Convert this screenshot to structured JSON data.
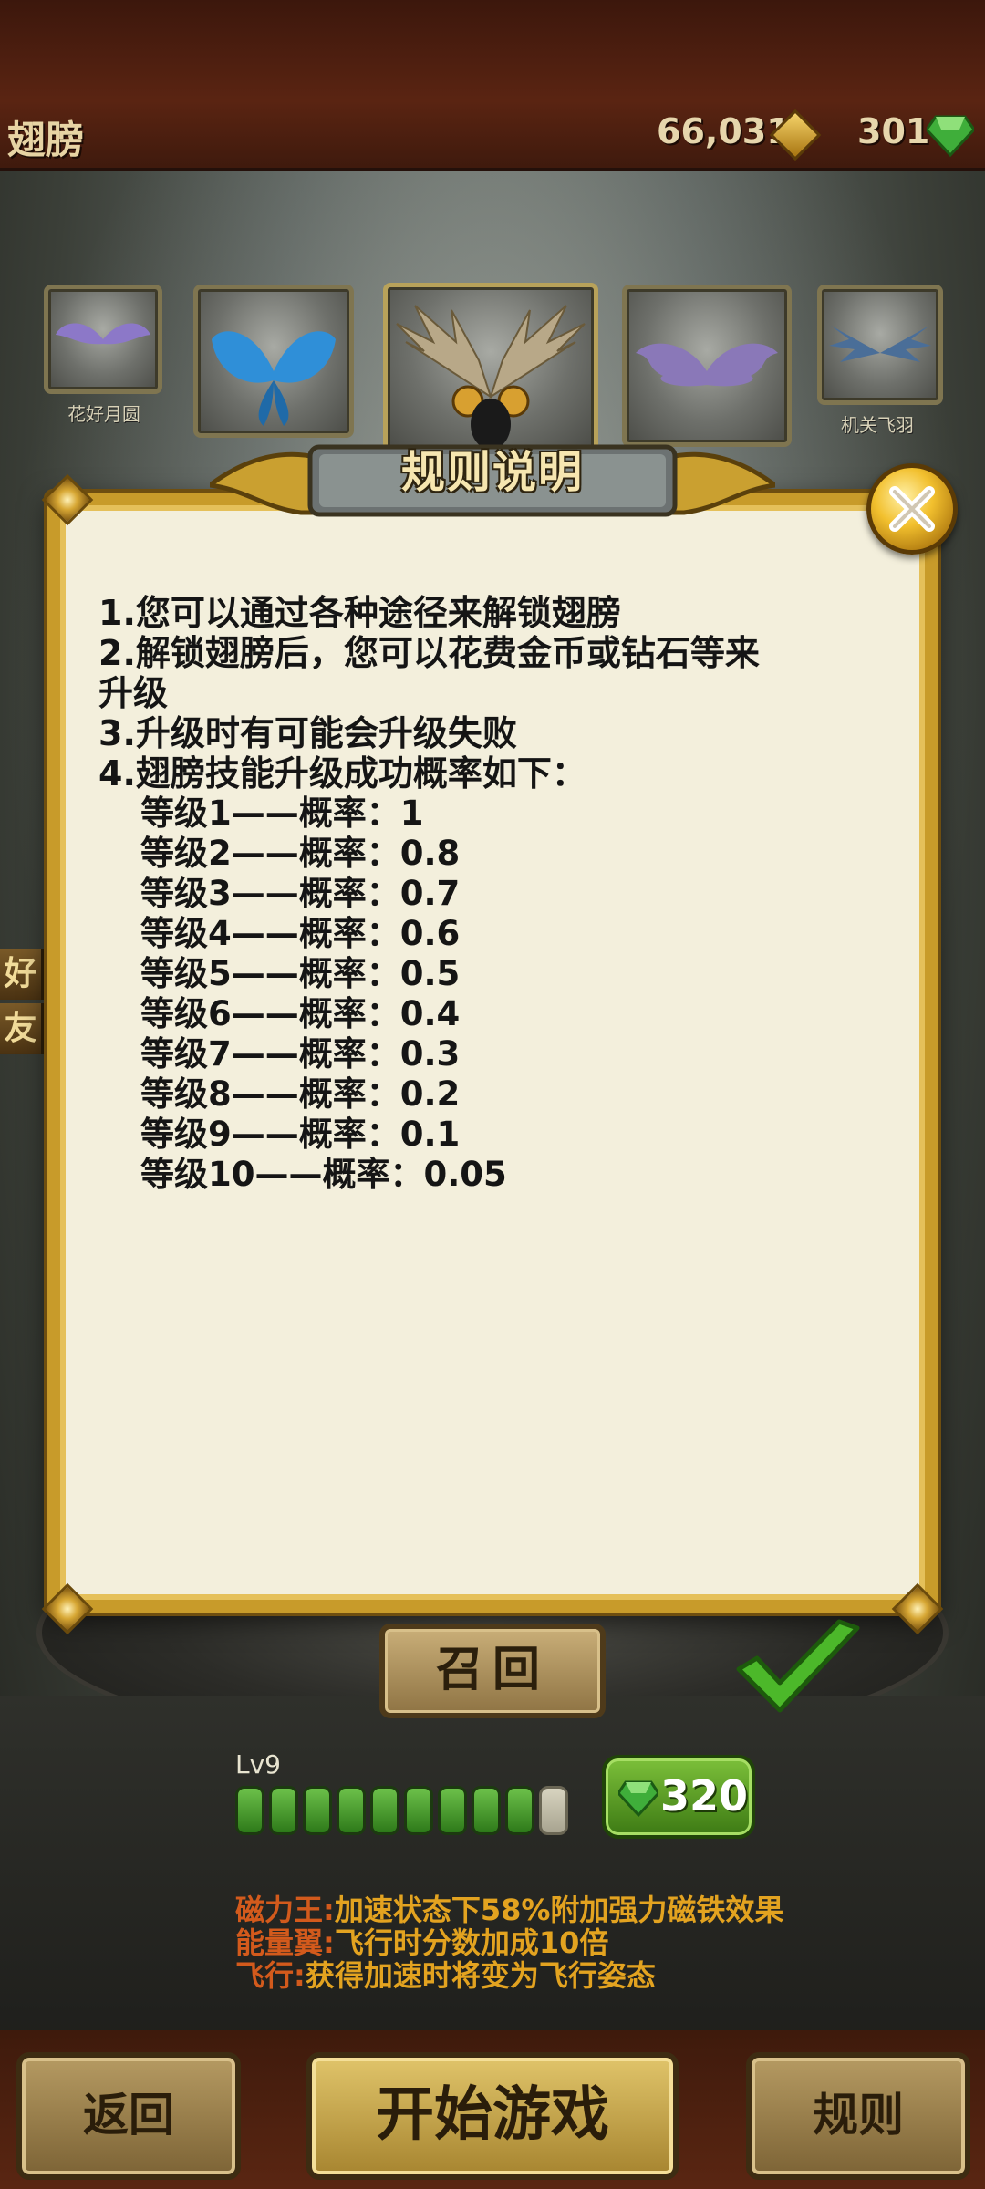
{
  "header": {
    "title": "翅膀",
    "gold": "66,031",
    "gems": "301"
  },
  "wings": [
    {
      "name": "花好月圆",
      "color": "#8c78c8"
    },
    {
      "name": "",
      "color": "#2f8fd8"
    },
    {
      "name": "",
      "color": "#b8a888"
    },
    {
      "name": "",
      "color": "#8a78b8"
    },
    {
      "name": "机关飞羽",
      "color": "#4a6e98"
    }
  ],
  "side_tabs": [
    "好",
    "友"
  ],
  "rules_dialog": {
    "title": "规则说明",
    "lines": [
      "1.您可以通过各种途径来解锁翅膀",
      "2.解锁翅膀后，您可以花费金币或钻石等来",
      "升级",
      "3.升级时有可能会升级失败",
      "4.翅膀技能升级成功概率如下："
    ],
    "levels": [
      "等级1——概率：1",
      "等级2——概率：0.8",
      "等级3——概率：0.7",
      "等级4——概率：0.6",
      "等级5——概率：0.5",
      "等级6——概率：0.4",
      "等级7——概率：0.3",
      "等级8——概率：0.2",
      "等级9——概率：0.1",
      "等级10——概率：0.05"
    ]
  },
  "recall_button": "召回",
  "level": {
    "label": "Lv9",
    "filled": 9,
    "total": 10
  },
  "upgrade": {
    "cost": "320"
  },
  "skills": [
    {
      "name": "磁力王:",
      "desc": "加速状态下58%附加强力磁铁效果"
    },
    {
      "name": "能量翼:",
      "desc": "飞行时分数加成10倍"
    },
    {
      "name": "飞行:",
      "desc": "获得加速时将变为飞行姿态"
    }
  ],
  "buttons": {
    "back": "返回",
    "start": "开始游戏",
    "rules": "规则"
  },
  "colors": {
    "dialog_border": "#c89b2a",
    "dialog_bg": "#f3efdc",
    "skill_name": "#d35a1c",
    "skill_desc": "#e3a320",
    "gem_green": "#3fae3a"
  }
}
